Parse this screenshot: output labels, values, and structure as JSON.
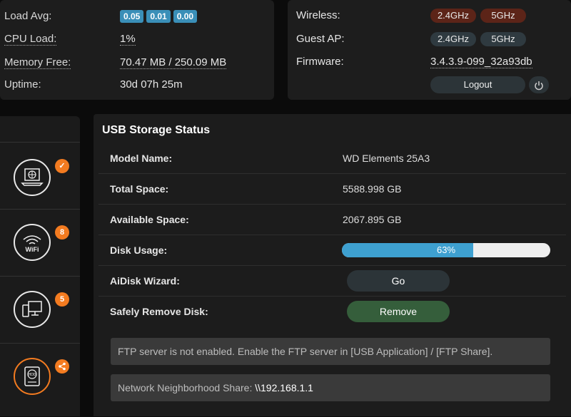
{
  "system": {
    "load_avg_label": "Load Avg:",
    "load_avg": [
      "0.05",
      "0.01",
      "0.00"
    ],
    "cpu_label": "CPU Load:",
    "cpu_value": "1%",
    "memory_label": "Memory Free:",
    "memory_value": "70.47 MB / 250.09 MB",
    "uptime_label": "Uptime:",
    "uptime_value": "30d 07h 25m"
  },
  "network": {
    "wireless_label": "Wireless:",
    "wireless_24": "2.4GHz",
    "wireless_5": "5GHz",
    "guest_label": "Guest AP:",
    "guest_24": "2.4GHz",
    "guest_5": "5GHz",
    "firmware_label": "Firmware:",
    "firmware_value": "3.4.3.9-099_32a93db",
    "logout_label": "Logout"
  },
  "sidebar": {
    "items": [
      {
        "icon": "internet-icon",
        "badge": "✓"
      },
      {
        "icon": "wifi-icon",
        "icon_label": "WiFi",
        "badge": "8"
      },
      {
        "icon": "clients-icon",
        "badge": "5"
      },
      {
        "icon": "hdd-icon",
        "icon_label": "HDD",
        "badge": "share"
      }
    ]
  },
  "usb": {
    "title": "USB Storage Status",
    "model_label": "Model Name:",
    "model_value": "WD Elements 25A3",
    "total_label": "Total Space:",
    "total_value": "5588.998 GB",
    "available_label": "Available Space:",
    "available_value": "2067.895 GB",
    "usage_label": "Disk Usage:",
    "usage_percent": 63,
    "usage_text": "63%",
    "aidisk_label": "AiDisk Wizard:",
    "go_label": "Go",
    "safely_label": "Safely Remove Disk:",
    "remove_label": "Remove",
    "ftp_notice": "FTP server is not enabled. Enable the FTP server in [USB Application] / [FTP Share].",
    "share_label": "Network Neighborhood Share:",
    "share_path": "\\\\192.168.1.1"
  },
  "colors": {
    "accent_orange": "#f37b20",
    "usage_fill": "#3ea0d0",
    "remove_green": "#355e3b"
  }
}
